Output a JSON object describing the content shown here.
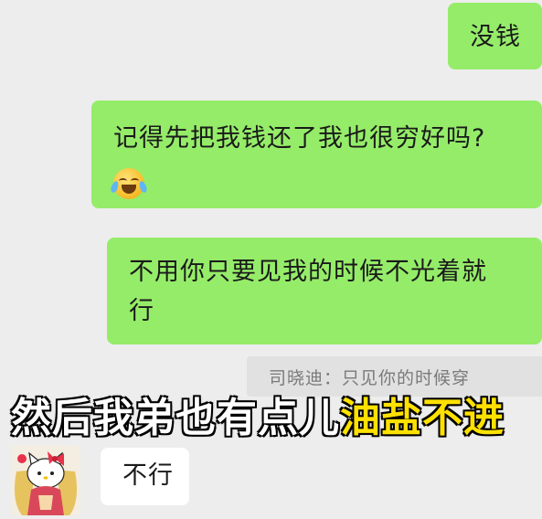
{
  "messages": [
    {
      "side": "me",
      "text": "没钱"
    },
    {
      "side": "me",
      "text": "记得先把我钱还了我也很穷好吗?",
      "emoji": "crying-laughing-emoji"
    },
    {
      "side": "me",
      "line1": "不用你只要见我的时候不光着就",
      "line2": "行"
    },
    {
      "side": "them",
      "text": "不行",
      "avatar": "hello-kitty-sticker-avatar"
    }
  ],
  "quote": {
    "text": "司晓迪：只见你的时候穿"
  },
  "caption": {
    "part1": "然后我弟也有点儿",
    "part2": "油盐不进",
    "color_part1": "#ffffff",
    "color_part2": "#ffe100"
  },
  "colors": {
    "background": "#ededed",
    "my_bubble": "#95ec69",
    "their_bubble": "#ffffff",
    "quote_bg": "#e1e1e1"
  }
}
